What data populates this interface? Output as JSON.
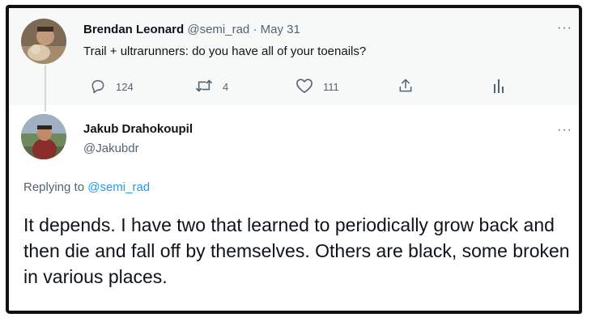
{
  "parent_tweet": {
    "author_name": "Brendan Leonard",
    "author_handle": "@semi_rad",
    "separator": "·",
    "date": "May 31",
    "text": "Trail + ultrarunners: do you have all of your toenails?",
    "reply_count": "124",
    "retweet_count": "4",
    "like_count": "111",
    "more_label": "···"
  },
  "reply_tweet": {
    "author_name": "Jakub Drahokoupil",
    "author_handle": "@Jakubdr",
    "replying_to_label": "Replying to",
    "replying_to_handle": "@semi_rad",
    "text": "It depends. I have two that learned to periodically grow back and then die and fall off by themselves. Others are black, some broken in various places.",
    "more_label": "···"
  },
  "colors": {
    "secondary_text": "#536471",
    "link": "#1d9bf0",
    "parent_bg": "#f7f9f9"
  },
  "icons": {
    "reply": "reply-icon",
    "retweet": "retweet-icon",
    "like": "heart-icon",
    "share": "share-icon",
    "analytics": "analytics-icon",
    "more": "more-icon"
  }
}
